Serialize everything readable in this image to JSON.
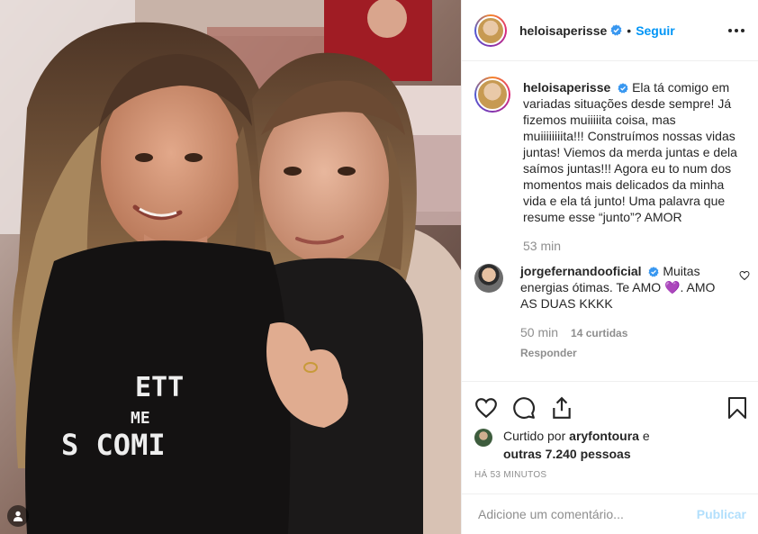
{
  "post": {
    "username": "heloisaperisse",
    "follow_label": "Seguir",
    "separator": "•",
    "caption": "Ela tá comigo em variadas situações desde sempre! Já fizemos muiiiiita coisa, mas muiiiiiiiita!!! Construímos nossas vidas juntas! Viemos da merda juntas e dela saímos juntas!!! Agora eu to num dos momentos mais delicados da minha vida e ela tá junto! Uma palavra que resume esse “junto”? AMOR",
    "caption_time": "53 min"
  },
  "reply": {
    "username": "jorgefernandooficial",
    "text_before": "Muitas energias ótimas. Te AMO ",
    "emoji": "💜",
    "text_after": ". AMO AS DUAS KKKK",
    "time": "50 min",
    "likes": "14 curtidas",
    "reply_label": "Responder"
  },
  "likes": {
    "prefix": "Curtido por",
    "user": "aryfontoura",
    "joiner": "e",
    "others": "outras 7.240 pessoas"
  },
  "timestamp": "HÁ 53 MINUTOS",
  "comment_box": {
    "placeholder": "Adicione um comentário...",
    "publish_label": "Publicar"
  },
  "photo": {
    "shirt_text": [
      "ETT",
      "ME",
      "S COMI"
    ]
  },
  "colors": {
    "link_blue": "#0095f6",
    "publish_disabled": "#b2dffc",
    "secondary_text": "#8e8e8e",
    "border": "#efefef",
    "verified": "#3897f0"
  },
  "icons": [
    "user-tag-icon",
    "verified-badge-icon",
    "more-options-icon",
    "like-heart-icon",
    "comment-icon",
    "share-icon",
    "save-bookmark-icon",
    "comment-like-icon"
  ]
}
